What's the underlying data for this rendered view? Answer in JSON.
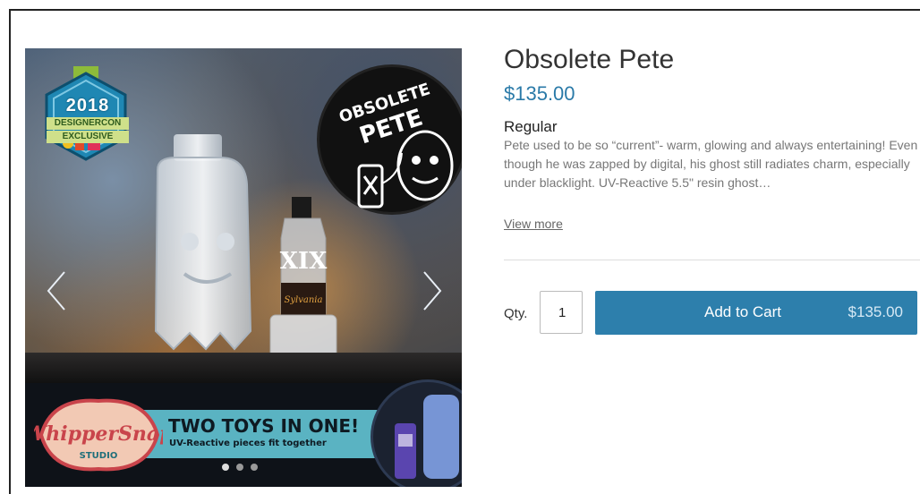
{
  "product": {
    "title": "Obsolete Pete",
    "price": "$135.00",
    "variant": "Regular",
    "description": "Pete used to be so “current”- warm, glowing and always entertaining! Even though he was zapped by digital, his ghost still radiates charm, especially under blacklight. UV-Reactive 5.5\" resin ghost…",
    "view_more": "View more"
  },
  "purchase": {
    "qty_label": "Qty.",
    "qty_value": "1",
    "add_to_cart_label": "Add to Cart",
    "add_to_cart_price": "$135.00"
  },
  "gallery": {
    "badge_year": "2018",
    "badge_line1": "DESIGNERCON",
    "badge_line2": "EXCLUSIVE",
    "logo_top": "OBSOLETE",
    "logo_main": "PETE",
    "banner_title": "TWO TOYS IN ONE!",
    "banner_sub": "UV-Reactive pieces fit together",
    "studio_name": "WhipperSnap",
    "studio_sub": "STUDIO",
    "slides": 3,
    "active_slide": 1
  },
  "colors": {
    "price": "#2a7aa8",
    "button": "#2d7fac",
    "badge_green": "#8dbb3a",
    "badge_blue": "#1f87b3",
    "banner_teal": "#5ab3c2"
  },
  "icons": {
    "prev": "chevron-left-icon",
    "next": "chevron-right-icon"
  }
}
